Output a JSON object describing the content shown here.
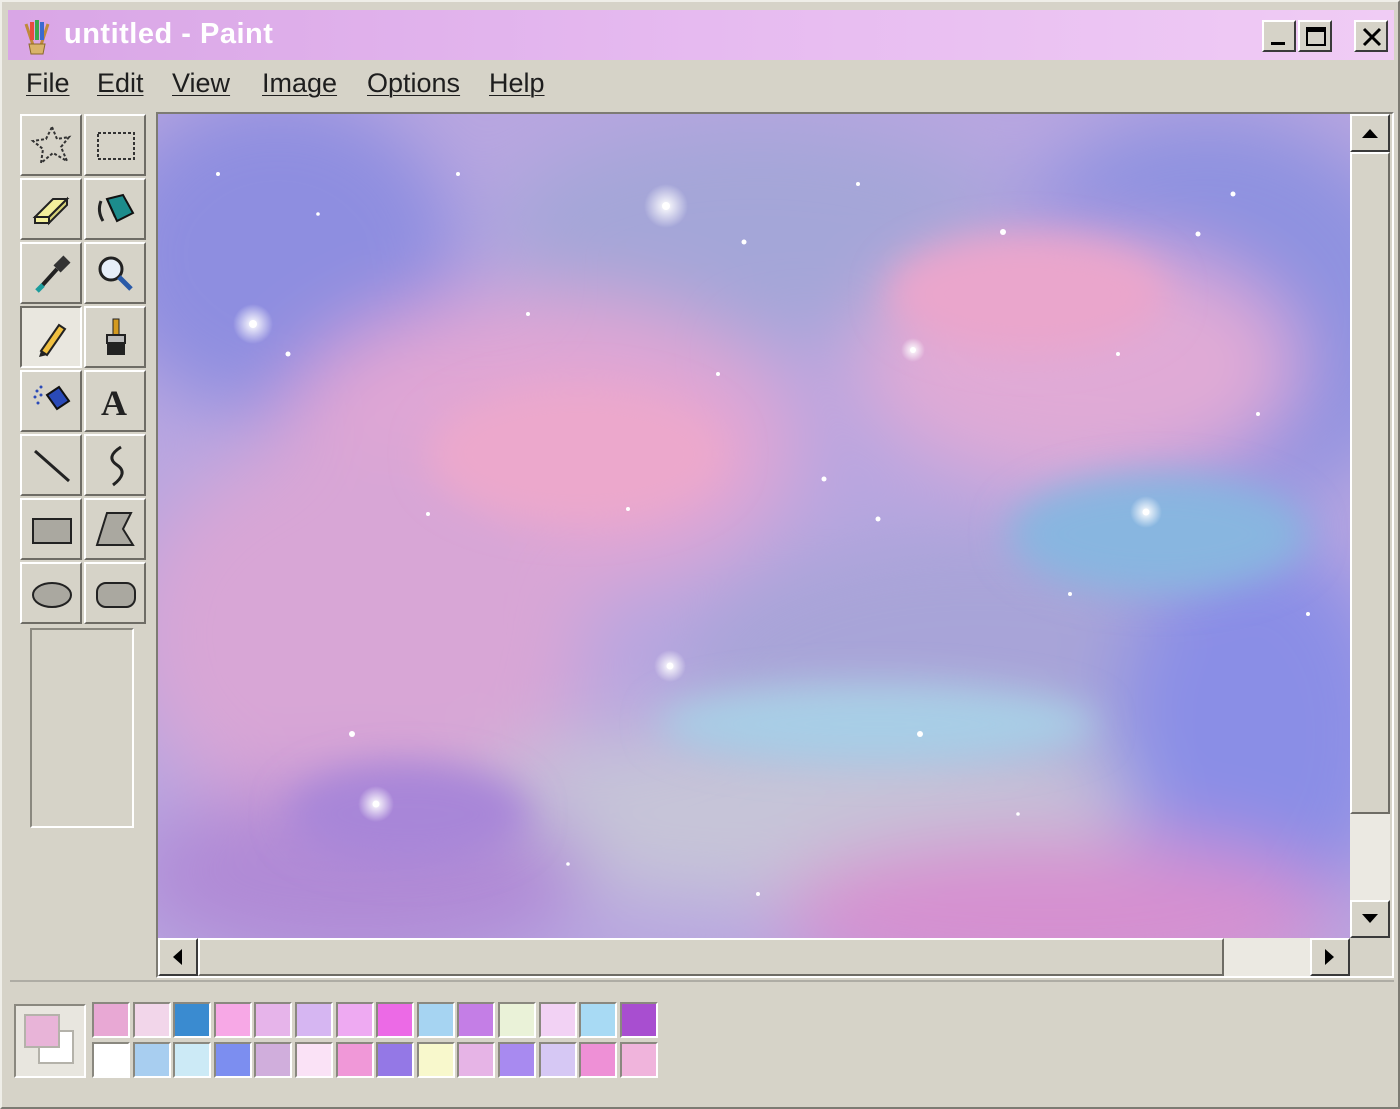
{
  "window": {
    "title": "untitled - Paint"
  },
  "menu": {
    "file": "File",
    "edit": "Edit",
    "view": "View",
    "image": "Image",
    "options": "Options",
    "help": "Help"
  },
  "toolbox": {
    "active_tool": "pencil",
    "tools": [
      "free-form-select",
      "select",
      "eraser",
      "fill-with-color",
      "pick-color",
      "magnifier",
      "pencil",
      "brush",
      "airbrush",
      "text",
      "line",
      "curve",
      "rectangle",
      "polygon",
      "ellipse",
      "rounded-rectangle"
    ]
  },
  "colors": {
    "foreground": "#e8b4d8",
    "background": "#ffffff",
    "palette_top": [
      "#e8a8d4",
      "#f2d6ea",
      "#3a8bd0",
      "#f7a8e6",
      "#e6b4ea",
      "#d6b6f2",
      "#eeaaf2",
      "#ec6ae6",
      "#a6d4f2",
      "#c47ee6",
      "#eaf2d8",
      "#f2d2f4",
      "#a8daf4",
      "#a84ed0"
    ],
    "palette_bottom": [
      "#ffffff",
      "#a8cef0",
      "#cceaf6",
      "#7c8ef0",
      "#d0aedc",
      "#fae2f6",
      "#f098d8",
      "#9478e6",
      "#f8f8cc",
      "#e6b4e6",
      "#a88af0",
      "#d6c8f4",
      "#ee90d6",
      "#f0b4dc"
    ]
  }
}
